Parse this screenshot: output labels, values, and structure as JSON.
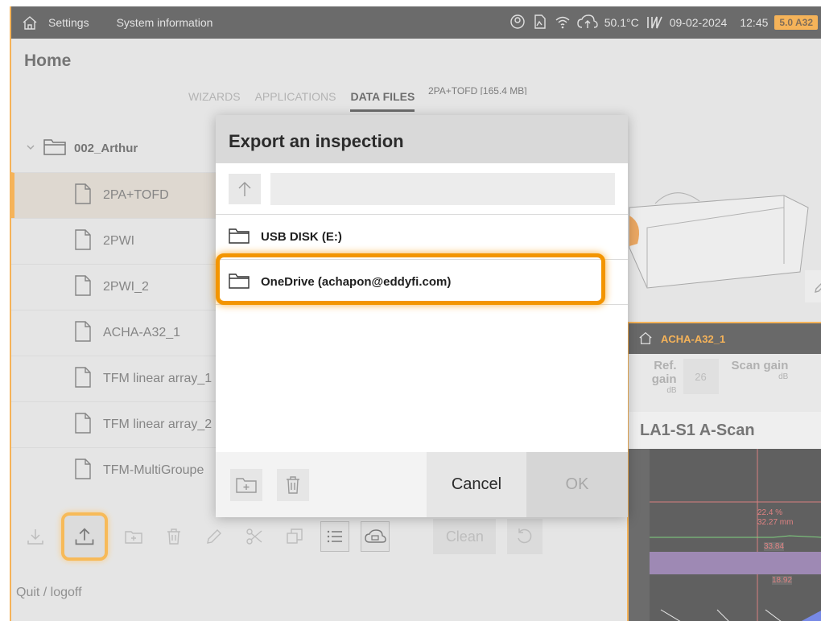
{
  "topbar": {
    "settings_label": "Settings",
    "sysinfo_label": "System information",
    "temperature": "50.1°C",
    "date": "09-02-2024",
    "time": "12:45",
    "device_badge": "5.0 A32"
  },
  "page": {
    "title": "Home"
  },
  "tabs": [
    {
      "label": "WIZARDS"
    },
    {
      "label": "APPLICATIONS"
    },
    {
      "label": "DATA FILES"
    }
  ],
  "selected_file_info": "2PA+TOFD [165.4 MB]",
  "filelist": {
    "folder": "002_Arthur",
    "files": [
      {
        "name": "2PA+TOFD"
      },
      {
        "name": "2PWI"
      },
      {
        "name": "2PWI_2"
      },
      {
        "name": "ACHA-A32_1"
      },
      {
        "name": "TFM linear array_1"
      },
      {
        "name": "TFM linear array_2"
      },
      {
        "name": "TFM-MultiGroupe"
      }
    ]
  },
  "toolbar": {
    "clean_label": "Clean",
    "quit_label": "Quit / logoff"
  },
  "inset": {
    "name": "ACHA-A32_1",
    "ref_gain_label": "Ref. gain",
    "ref_gain_unit": "dB",
    "ref_gain_value": "26",
    "scan_gain_label": "Scan gain",
    "scan_gain_unit": "dB",
    "ascan_title": "LA1-S1 A-Scan",
    "reading_pct": "22.4 %",
    "reading_mm": "32.27 mm",
    "gate_value": "33.84",
    "gate_value2": "18.92"
  },
  "dialog": {
    "title": "Export an inspection",
    "path_value": "",
    "entries": [
      {
        "name": "USB DISK (E:)"
      },
      {
        "name": "OneDrive (achapon@eddyfi.com)"
      }
    ],
    "cancel_label": "Cancel",
    "ok_label": "OK"
  },
  "colors": {
    "accent": "#f08a00",
    "highlight": "#f39500",
    "topbar": "#1c1c1c"
  }
}
